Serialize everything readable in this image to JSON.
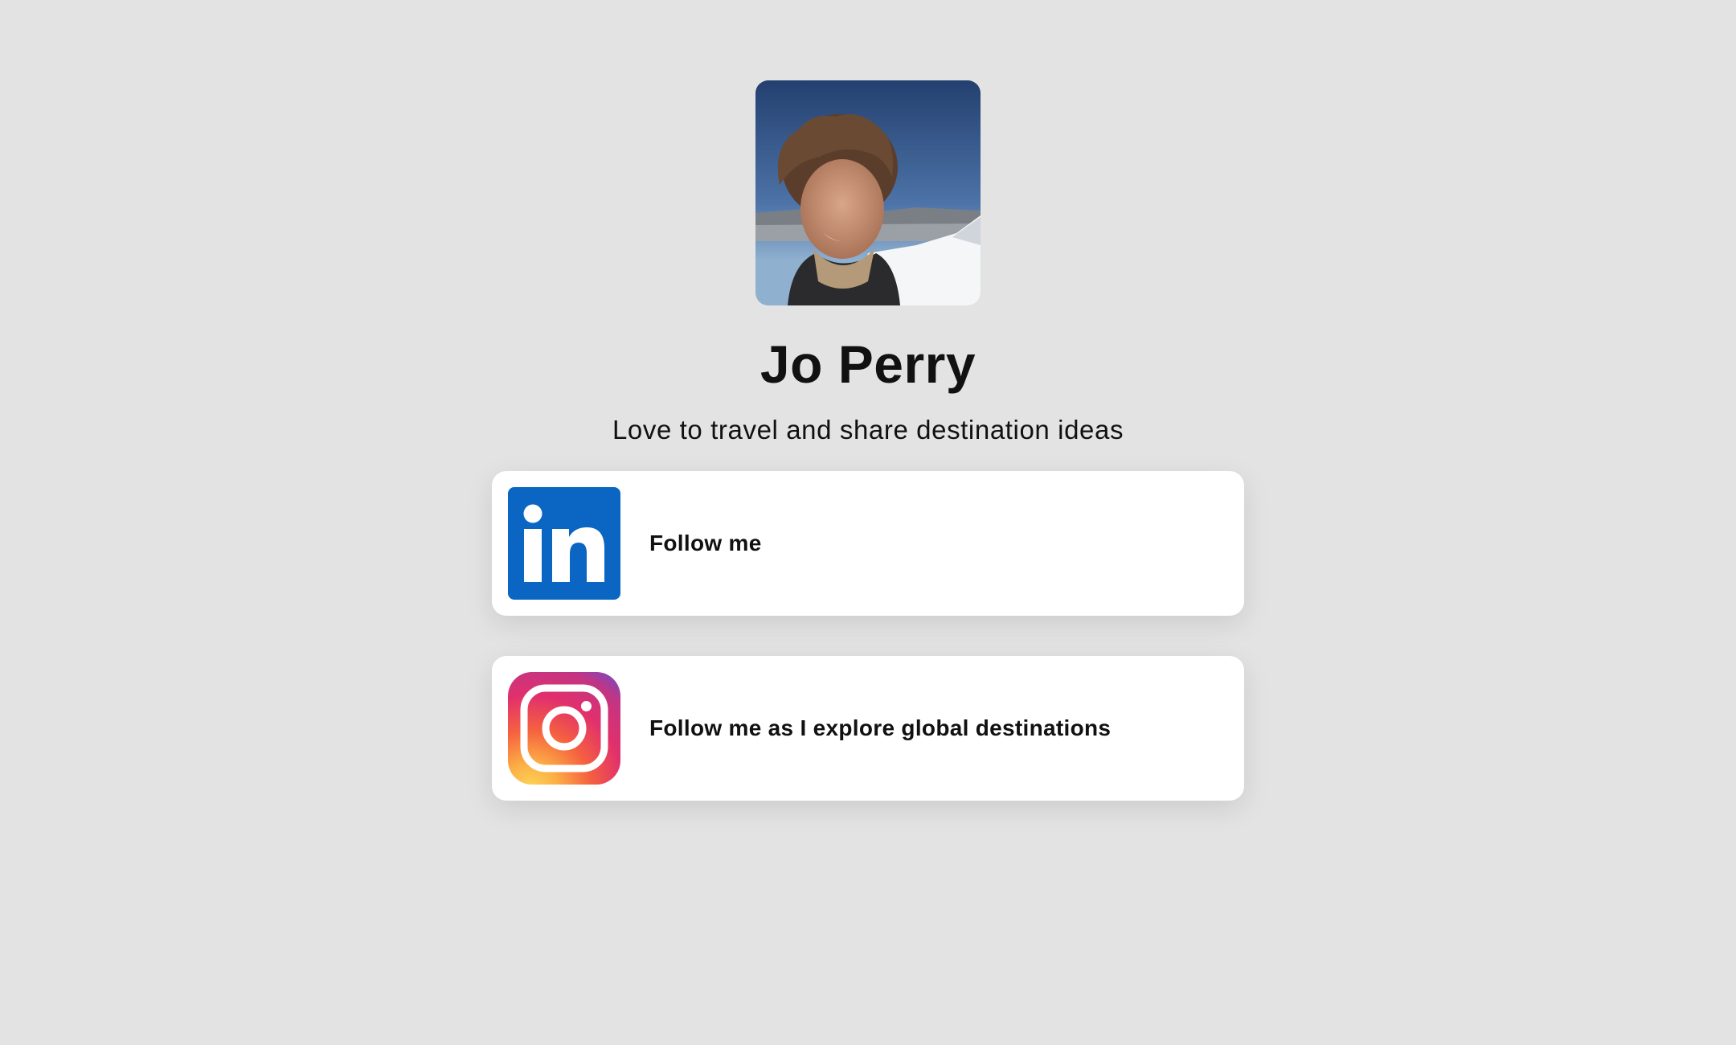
{
  "profile": {
    "name": "Jo Perry",
    "bio": "Love to travel and share destination ideas",
    "avatar": "profile-photo"
  },
  "links": [
    {
      "label": "Follow me",
      "icon": "linkedin-icon",
      "brand_color": "#0a66c2"
    },
    {
      "label": "Follow me as I explore global destinations",
      "icon": "instagram-icon",
      "brand_color": "#dd2a7b"
    }
  ],
  "colors": {
    "page_background": "#e3e3e3",
    "card_background": "#ffffff",
    "text": "#111111"
  }
}
